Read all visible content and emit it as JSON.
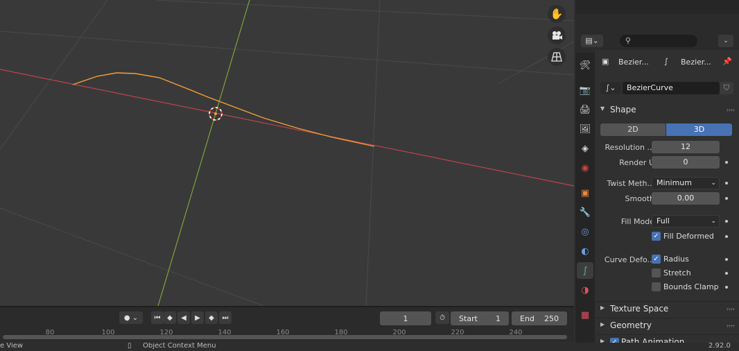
{
  "colors": {
    "accent": "#4772b3",
    "x_axis": "#c0424f",
    "y_axis": "#7ea33a",
    "curve": "#f5a035"
  },
  "viewport": {
    "nav_icons": [
      "hand-icon",
      "camera-icon",
      "grid-icon"
    ]
  },
  "timeline": {
    "current_frame": "1",
    "start_label": "Start",
    "start_value": "1",
    "end_label": "End",
    "end_value": "250",
    "ruler_ticks": [
      "80",
      "100",
      "120",
      "140",
      "160",
      "180",
      "200",
      "220",
      "240"
    ]
  },
  "statusbar": {
    "left_text": "e View",
    "context_menu": "Object Context Menu",
    "version": "2.92.0"
  },
  "properties": {
    "breadcrumb_object": "Bezier...",
    "breadcrumb_data": "Bezier...",
    "datablock_name": "BezierCurve",
    "shape_panel": {
      "title": "Shape",
      "dim_2d": "2D",
      "dim_3d": "3D",
      "resolution_label": "Resolution ...",
      "resolution_value": "12",
      "render_u_label": "Render U",
      "render_u_value": "0",
      "twist_label": "Twist Meth...",
      "twist_value": "Minimum",
      "smooth_label": "Smooth",
      "smooth_value": "0.00",
      "fill_mode_label": "Fill Mode",
      "fill_mode_value": "Full",
      "fill_deformed_label": "Fill Deformed",
      "curve_deform_label": "Curve Defo...",
      "radius_label": "Radius",
      "stretch_label": "Stretch",
      "bounds_clamp_label": "Bounds Clamp"
    },
    "panels": {
      "texture_space": "Texture Space",
      "geometry": "Geometry",
      "path_animation": "Path Animation"
    }
  }
}
